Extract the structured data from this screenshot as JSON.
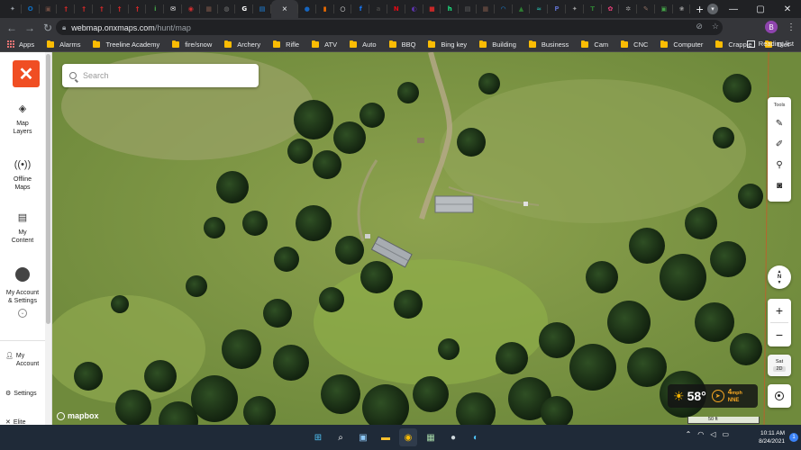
{
  "browser": {
    "tabs": [
      {
        "icon": "orvis-icon",
        "color": "#9aa0a6",
        "glyph": "✦"
      },
      {
        "icon": "outlook-icon",
        "color": "#0f6cbd",
        "glyph": "O"
      },
      {
        "icon": "forum-icon",
        "color": "#6d4c41",
        "glyph": "▣"
      },
      {
        "icon": "figure-red-icon",
        "color": "#c62828",
        "glyph": "†"
      },
      {
        "icon": "figure-red-icon",
        "color": "#c62828",
        "glyph": "†"
      },
      {
        "icon": "figure-red-icon",
        "color": "#c62828",
        "glyph": "†"
      },
      {
        "icon": "figure-red-icon",
        "color": "#c62828",
        "glyph": "†"
      },
      {
        "icon": "figure-red-icon",
        "color": "#c62828",
        "glyph": "†"
      },
      {
        "icon": "info-green-icon",
        "color": "#43a047",
        "glyph": "i"
      },
      {
        "icon": "mail-icon",
        "color": "#ffffff",
        "glyph": "✉"
      },
      {
        "icon": "red-circle-icon",
        "color": "#d32f2f",
        "glyph": "◉"
      },
      {
        "icon": "grid-icon",
        "color": "#795548",
        "glyph": "▦"
      },
      {
        "icon": "globe-icon",
        "color": "#757575",
        "glyph": "◍"
      },
      {
        "icon": "google-icon",
        "color": "#ffffff",
        "glyph": "G"
      },
      {
        "icon": "blue-box-icon",
        "color": "#1e88e5",
        "glyph": "▤"
      },
      {
        "icon": "active-tab-icon",
        "color": "#e8eaed",
        "glyph": "×"
      },
      {
        "icon": "blue-circle-icon",
        "color": "#1565c0",
        "glyph": "●"
      },
      {
        "icon": "orange-icon",
        "color": "#ef6c00",
        "glyph": "▮"
      },
      {
        "icon": "white-circle-icon",
        "color": "#ffffff",
        "glyph": "○"
      },
      {
        "icon": "facebook-icon",
        "color": "#1877f2",
        "glyph": "f"
      },
      {
        "icon": "app-dark-icon",
        "color": "#424242",
        "glyph": "a"
      },
      {
        "icon": "netflix-icon",
        "color": "#e50914",
        "glyph": "N"
      },
      {
        "icon": "purple-icon",
        "color": "#5e35b1",
        "glyph": "◐"
      },
      {
        "icon": "red-square-icon",
        "color": "#c62828",
        "glyph": "■"
      },
      {
        "icon": "hulu-icon",
        "color": "#1ce783",
        "glyph": "h"
      },
      {
        "icon": "list-icon",
        "color": "#616161",
        "glyph": "▤"
      },
      {
        "icon": "grid2-icon",
        "color": "#795548",
        "glyph": "▦"
      },
      {
        "icon": "arc-icon",
        "color": "#1e88e5",
        "glyph": "◠"
      },
      {
        "icon": "mountain-icon",
        "color": "#2e7d32",
        "glyph": "▲"
      },
      {
        "icon": "mint-icon",
        "color": "#26a69a",
        "glyph": "≈"
      },
      {
        "icon": "paramount-icon",
        "color": "#5c6bc0",
        "glyph": "P"
      },
      {
        "icon": "bird-icon",
        "color": "#9e9e9e",
        "glyph": "✦"
      },
      {
        "icon": "td-icon",
        "color": "#2e7d32",
        "glyph": "T"
      },
      {
        "icon": "flower-icon",
        "color": "#ec407a",
        "glyph": "✿"
      },
      {
        "icon": "settings-icon",
        "color": "#9e9e9e",
        "glyph": "✲"
      },
      {
        "icon": "feather-icon",
        "color": "#8d6e63",
        "glyph": "✎"
      },
      {
        "icon": "green-box-icon",
        "color": "#43a047",
        "glyph": "▣"
      },
      {
        "icon": "wheel-icon",
        "color": "#9e9e9e",
        "glyph": "❀"
      }
    ],
    "new_tab": "+",
    "address": {
      "domain": "webmap.onxmaps.com",
      "path": "/hunt/map"
    },
    "profile_initial": "B",
    "bookmarks": [
      {
        "label": "Apps",
        "type": "apps"
      },
      {
        "label": "Alarms",
        "type": "folder"
      },
      {
        "label": "Treeline Academy",
        "type": "folder"
      },
      {
        "label": "fire/snow",
        "type": "folder"
      },
      {
        "label": "Archery",
        "type": "folder"
      },
      {
        "label": "Rifle",
        "type": "folder"
      },
      {
        "label": "ATV",
        "type": "folder"
      },
      {
        "label": "Auto",
        "type": "folder"
      },
      {
        "label": "BBQ",
        "type": "folder"
      },
      {
        "label": "Bing key",
        "type": "folder"
      },
      {
        "label": "Building",
        "type": "folder"
      },
      {
        "label": "Business",
        "type": "folder"
      },
      {
        "label": "Cam",
        "type": "folder"
      },
      {
        "label": "CNC",
        "type": "folder"
      },
      {
        "label": "Computer",
        "type": "folder"
      },
      {
        "label": "Crappie",
        "type": "folder"
      },
      {
        "label": "Diet",
        "type": "folder"
      }
    ],
    "bookmarks_more": "»",
    "reading_list": "Reading list"
  },
  "sidebar": {
    "logo": "✕",
    "items": [
      {
        "label": "Map Layers",
        "icon": "layers-icon"
      },
      {
        "label": "Offline Maps",
        "icon": "offline-icon"
      },
      {
        "label": "My Content",
        "icon": "content-icon"
      },
      {
        "label": "My Account & Settings",
        "icon": "avatar"
      }
    ],
    "links": [
      {
        "label": "My Account",
        "icon": "user-icon"
      },
      {
        "label": "Settings",
        "icon": "gear-icon"
      },
      {
        "label": "Elite",
        "icon": "close-icon"
      }
    ]
  },
  "map": {
    "search_placeholder": "Search",
    "tools_label": "Tools",
    "compass_label": "N",
    "zoom_in": "+",
    "zoom_out": "−",
    "basemap_label": "Sat",
    "basemap_mode": "2D",
    "weather": {
      "temp": "58°",
      "wind_speed": "4",
      "wind_unit": "mph",
      "wind_dir": "NNE"
    },
    "attribution": "mapbox",
    "scale": "50 ft"
  },
  "taskbar": {
    "time": "10:11 AM",
    "date": "8/24/2021",
    "notifications": "1"
  },
  "colors": {
    "brand": "#f04e23",
    "wind": "#f5a623",
    "sun": "#f5b400"
  }
}
